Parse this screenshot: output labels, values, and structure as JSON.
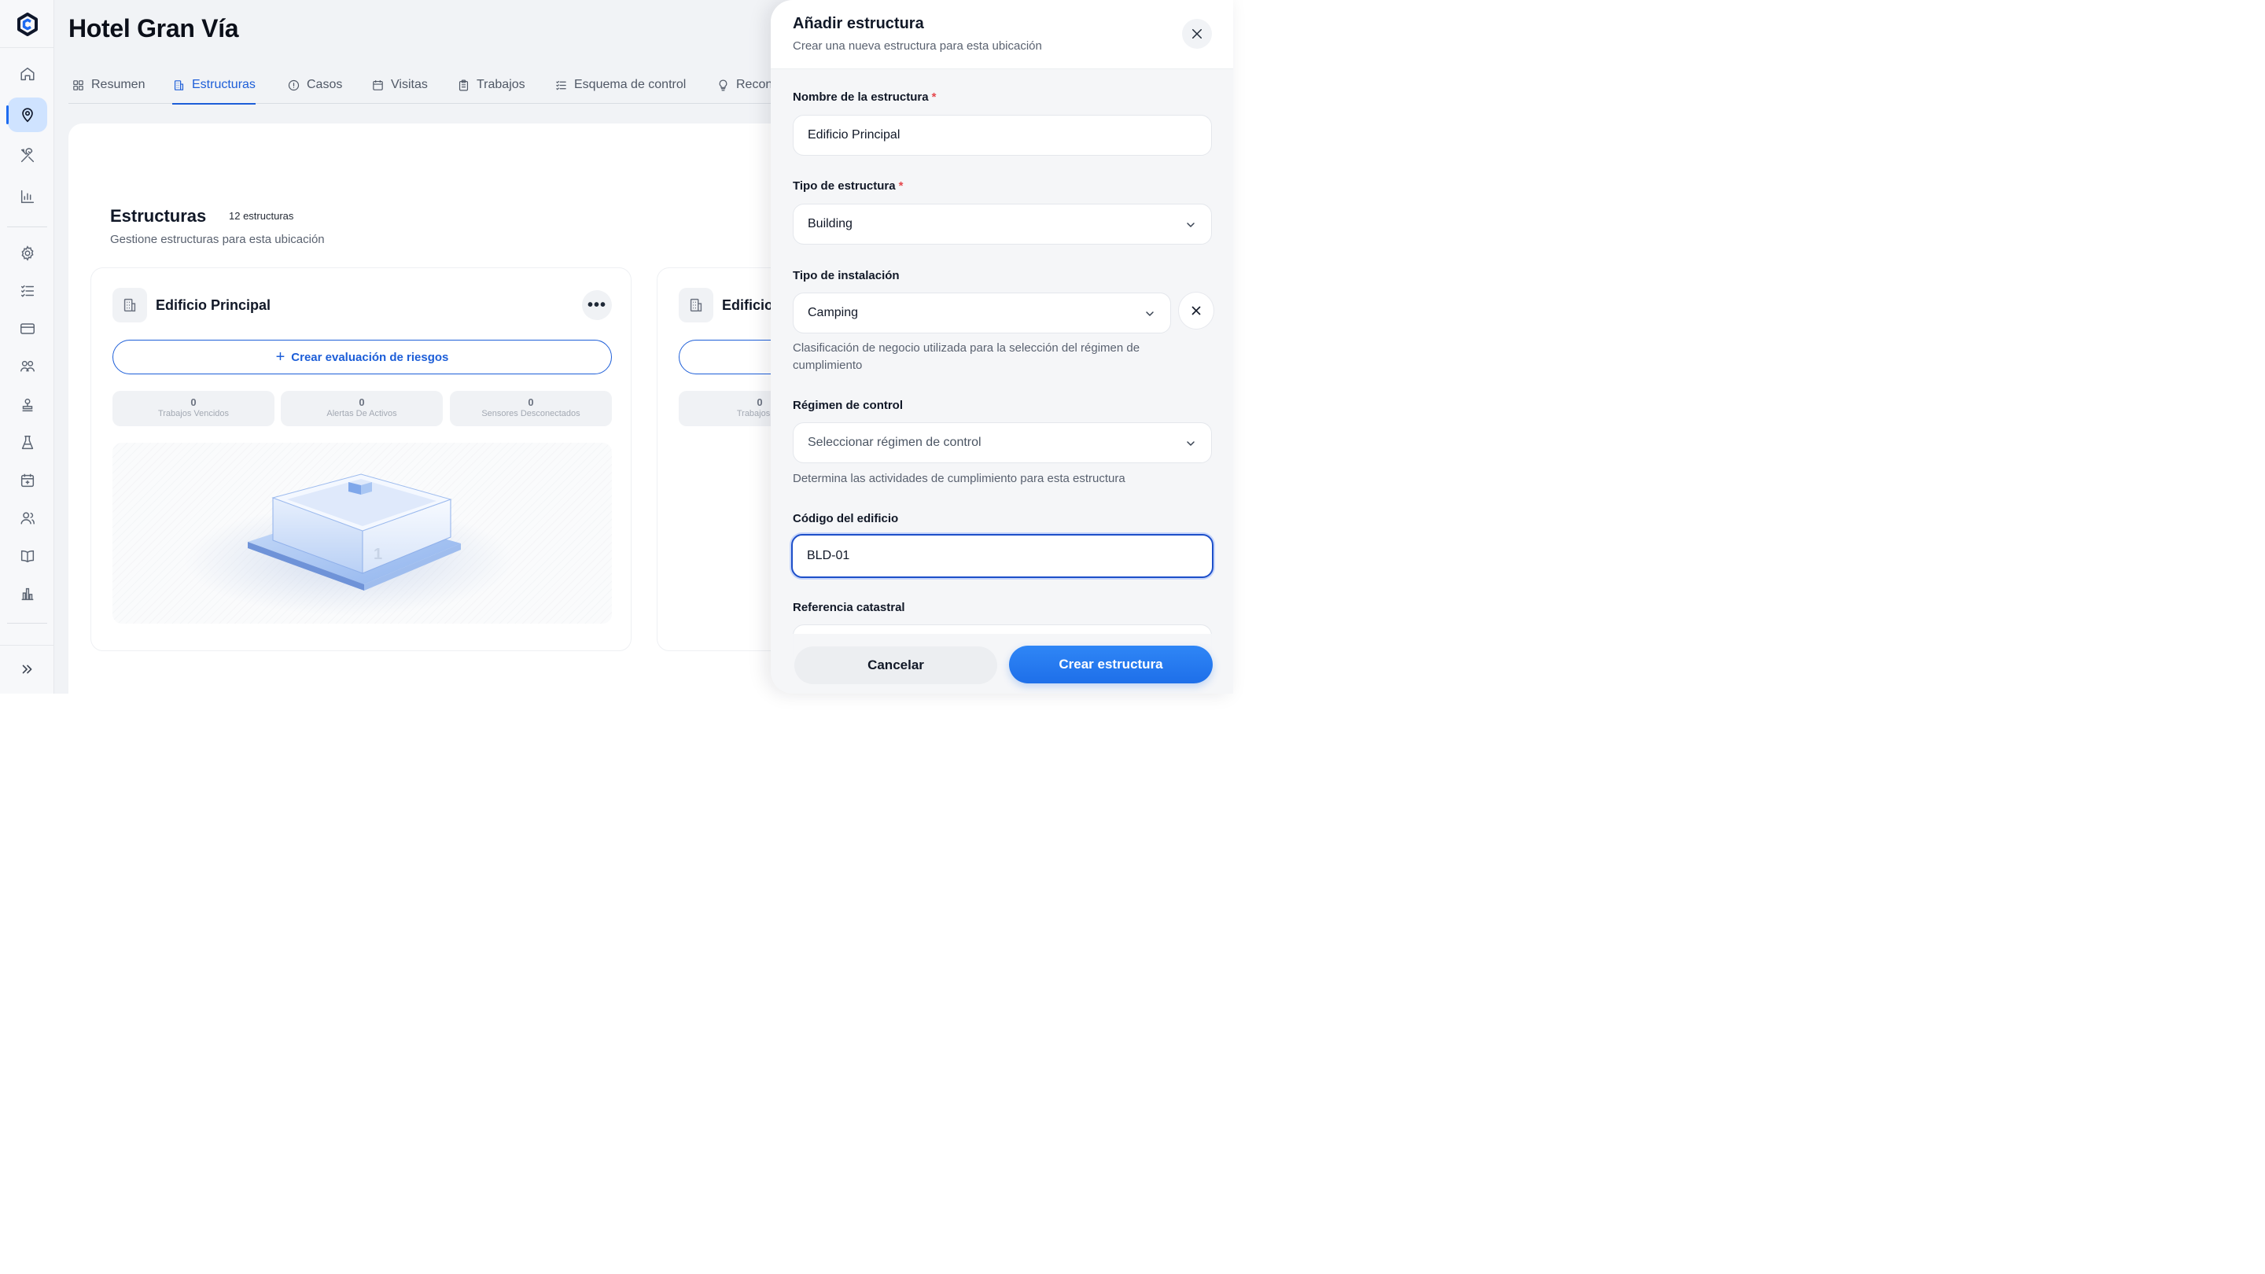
{
  "header": {
    "title": "Hotel Gran Vía"
  },
  "tabs": [
    {
      "label": "Resumen",
      "icon": "dashboard-icon"
    },
    {
      "label": "Estructuras",
      "icon": "building-icon",
      "active": true
    },
    {
      "label": "Casos",
      "icon": "alert-circle-icon"
    },
    {
      "label": "Visitas",
      "icon": "calendar-icon"
    },
    {
      "label": "Trabajos",
      "icon": "clipboard-icon"
    },
    {
      "label": "Esquema de control",
      "icon": "checklist-icon"
    },
    {
      "label": "Recon",
      "icon": "lightbulb-icon"
    }
  ],
  "section": {
    "title": "Estructuras",
    "count": "12 estructuras",
    "subtitle": "Gestione estructuras para esta ubicación"
  },
  "cards": [
    {
      "name": "Edificio Principal",
      "button": "Crear evaluación de riesgos",
      "stats": [
        {
          "value": "0",
          "label": "Trabajos Vencidos"
        },
        {
          "value": "0",
          "label": "Alertas De Activos"
        },
        {
          "value": "0",
          "label": "Sensores Desconectados"
        }
      ],
      "illustration_number": "1"
    },
    {
      "name": "Edificio",
      "stats": [
        {
          "value": "0",
          "label": "Trabajos Ve"
        }
      ]
    }
  ],
  "panel": {
    "title": "Añadir estructura",
    "subtitle": "Crear una nueva estructura para esta ubicación",
    "required_mark": "*",
    "fields": {
      "name": {
        "label": "Nombre de la estructura",
        "value": "Edificio Principal"
      },
      "type": {
        "label": "Tipo de estructura",
        "value": "Building"
      },
      "installation": {
        "label": "Tipo de instalación",
        "value": "Camping",
        "help": "Clasificación de negocio utilizada para la selección del régimen de cumplimiento"
      },
      "regime": {
        "label": "Régimen de control",
        "placeholder": "Seleccionar régimen de control",
        "help": "Determina las actividades de cumplimiento para esta estructura"
      },
      "code": {
        "label": "Código del edificio",
        "value": "BLD-01"
      },
      "cadastral": {
        "label": "Referencia catastral"
      }
    },
    "cancel_label": "Cancelar",
    "create_label": "Crear estructura"
  },
  "colors": {
    "accent": "#1d5ed8",
    "primary_button": "#2079ef",
    "required": "#e5484d",
    "active_nav_bg": "#cfe3ff"
  }
}
